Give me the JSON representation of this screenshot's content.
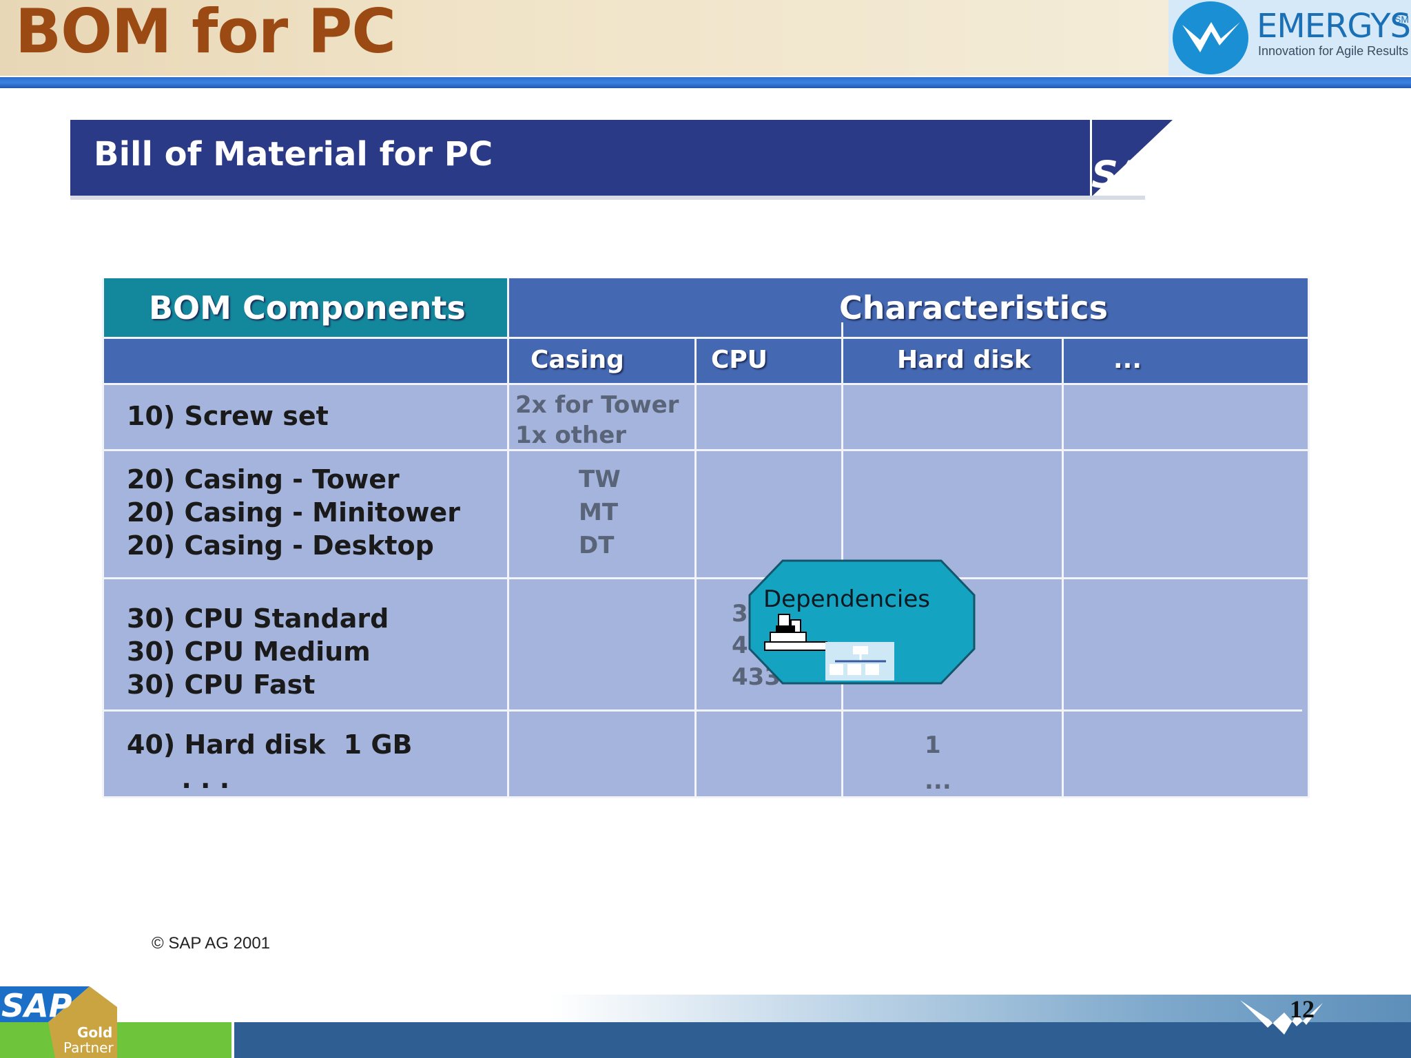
{
  "header": {
    "title": "BOM for PC",
    "logo_name": "EMERGYS",
    "logo_sm": "SM",
    "logo_tagline": "Innovation for Agile Results"
  },
  "banner": {
    "title": "Bill of Material for PC",
    "sap_logo": "SAP"
  },
  "table": {
    "header_left": "BOM Components",
    "header_right": "Characteristics",
    "columns": [
      "Casing",
      "CPU",
      "Hard disk",
      "..."
    ],
    "rows": [
      {
        "component": "10) Screw set",
        "casing": "2x for Tower\n1x other",
        "cpu": "",
        "hard_disk": ""
      },
      {
        "component": "20) Casing - Tower\n20) Casing - Minitower\n20) Casing - Desktop",
        "casing": "TW\nMT\nDT",
        "cpu": "",
        "hard_disk": ""
      },
      {
        "component": "30) CPU Standard\n30) CPU Medium\n30) CPU Fast",
        "casing": "",
        "cpu": "3\n4\n433",
        "hard_disk": ""
      },
      {
        "component": "40) Hard disk  1 GB\n      . . .",
        "casing": "",
        "cpu": "",
        "hard_disk": "1\n..."
      }
    ]
  },
  "dependencies_label": "Dependencies",
  "footer": {
    "copyright": "©  SAP AG 2001",
    "sap_partner": [
      "SAP",
      "Gold",
      "Partner"
    ],
    "page_number": "12"
  }
}
